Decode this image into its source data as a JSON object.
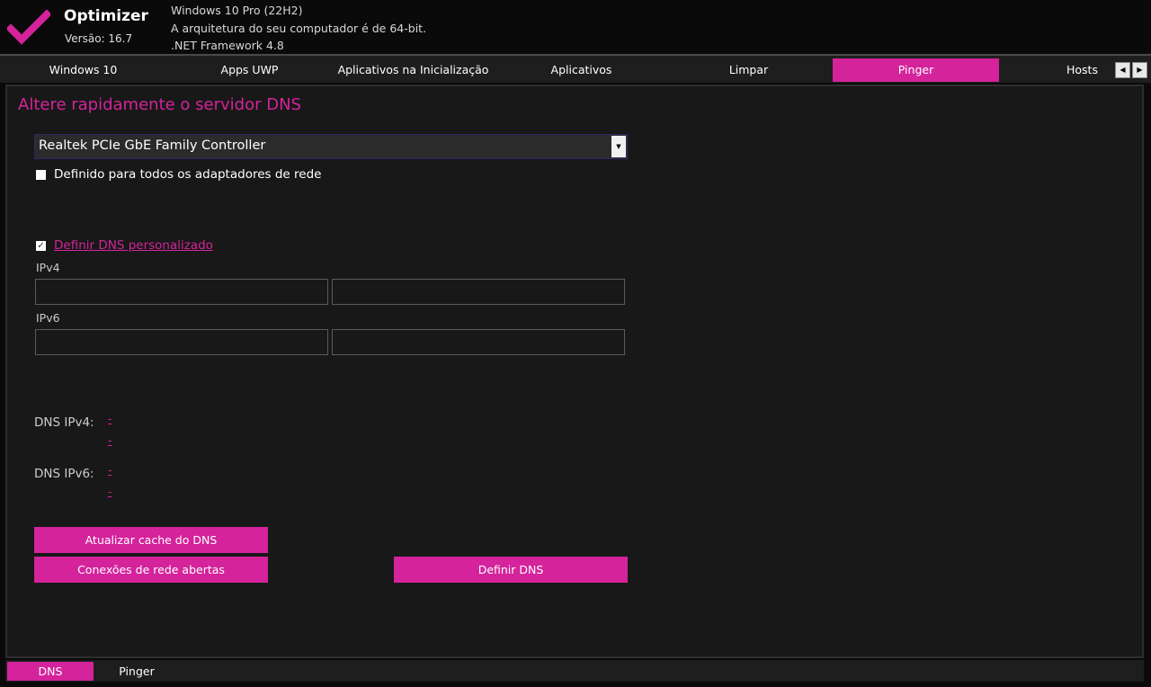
{
  "app": {
    "name": "Optimizer",
    "version": "Versão: 16.7"
  },
  "system_info": {
    "os": "Windows 10 Pro (22H2)",
    "arch": "A arquitetura do seu computador é de 64-bit.",
    "framework": ".NET Framework 4.8"
  },
  "tabs": [
    {
      "label": "Windows 10",
      "active": false
    },
    {
      "label": "Apps UWP",
      "active": false
    },
    {
      "label": "Aplicativos na Inicialização",
      "active": false
    },
    {
      "label": "Aplicativos",
      "active": false
    },
    {
      "label": "Limpar",
      "active": false
    },
    {
      "label": "Pinger",
      "active": true
    },
    {
      "label": "Hosts",
      "active": false
    }
  ],
  "main": {
    "heading": "Altere rapidamente o servidor DNS",
    "adapter": {
      "selected": "Realtek PCIe GbE Family Controller"
    },
    "all_adapters": {
      "label": "Definido para todos os adaptadores de rede",
      "checked": false
    },
    "custom_dns": {
      "label": "Definir DNS personalizado",
      "checked": true
    },
    "ipv4_label": "IPv4",
    "ipv6_label": "IPv6",
    "ipv4_primary": "",
    "ipv4_secondary": "",
    "ipv6_primary": "",
    "ipv6_secondary": "",
    "dns_ipv4": {
      "label": "DNS IPv4:",
      "value1": "-",
      "value2": "-"
    },
    "dns_ipv6": {
      "label": "DNS IPv6:",
      "value1": "-",
      "value2": "-"
    },
    "buttons": {
      "flush": "Atualizar cache do DNS",
      "connections": "Conexões de rede abertas",
      "set_dns": "Definir DNS"
    }
  },
  "bottom_tabs": [
    {
      "label": "DNS",
      "active": true
    },
    {
      "label": "Pinger",
      "active": false
    }
  ],
  "icons": {
    "logo": "checkmark-icon",
    "dropdown": "caret-down-icon",
    "scroll_left": "arrow-left-icon",
    "scroll_right": "arrow-right-icon"
  },
  "colors": {
    "accent": "#d4239b",
    "background": "#181818",
    "header": "#0a0a0a"
  }
}
